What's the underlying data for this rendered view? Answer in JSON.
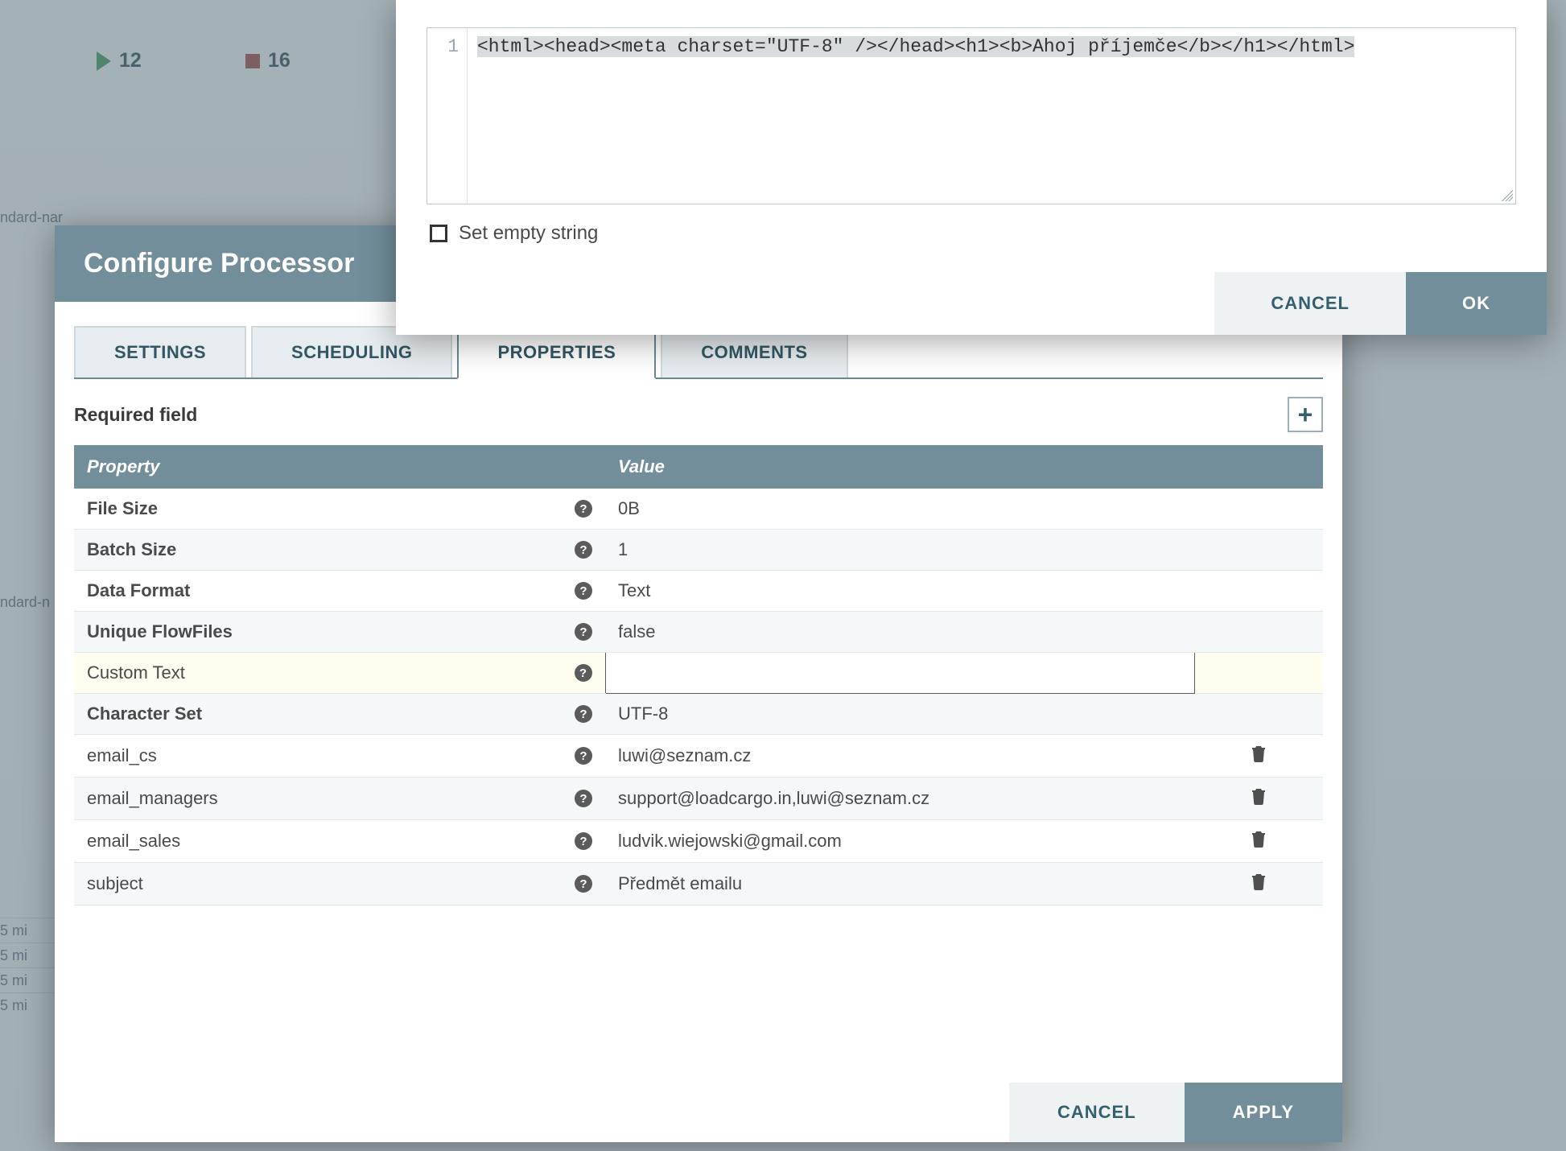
{
  "background": {
    "run_count": "12",
    "stop_count": "16",
    "label1": "ndard-nar",
    "label2": "ndard-n",
    "small_line": "5 mi"
  },
  "configure_dialog": {
    "title": "Configure Processor",
    "tabs": {
      "settings": "SETTINGS",
      "scheduling": "SCHEDULING",
      "properties": "PROPERTIES",
      "comments": "COMMENTS"
    },
    "required_label": "Required field",
    "headers": {
      "property": "Property",
      "value": "Value"
    },
    "rows": [
      {
        "name": "File Size",
        "value": "0B",
        "bold": true,
        "deletable": false
      },
      {
        "name": "Batch Size",
        "value": "1",
        "bold": true,
        "deletable": false
      },
      {
        "name": "Data Format",
        "value": "Text",
        "bold": true,
        "deletable": false
      },
      {
        "name": "Unique FlowFiles",
        "value": "false",
        "bold": true,
        "deletable": false
      },
      {
        "name": "Custom Text",
        "value": "",
        "bold": false,
        "deletable": false,
        "highlight": true
      },
      {
        "name": "Character Set",
        "value": "UTF-8",
        "bold": true,
        "deletable": false
      },
      {
        "name": "email_cs",
        "value": "luwi@seznam.cz",
        "bold": false,
        "deletable": true
      },
      {
        "name": "email_managers",
        "value": "support@loadcargo.in,luwi@seznam.cz",
        "bold": false,
        "deletable": true
      },
      {
        "name": "email_sales",
        "value": "ludvik.wiejowski@gmail.com",
        "bold": false,
        "deletable": true
      },
      {
        "name": "subject",
        "value": "Předmět emailu",
        "bold": false,
        "deletable": true
      }
    ],
    "buttons": {
      "cancel": "CANCEL",
      "apply": "APPLY"
    }
  },
  "editor_popup": {
    "line_number": "1",
    "code": "<html><head><meta charset=\"UTF-8\" /></head><h1><b>Ahoj příjemče</b></h1></html>",
    "checkbox_label": "Set empty string",
    "buttons": {
      "cancel": "CANCEL",
      "ok": "OK"
    }
  }
}
